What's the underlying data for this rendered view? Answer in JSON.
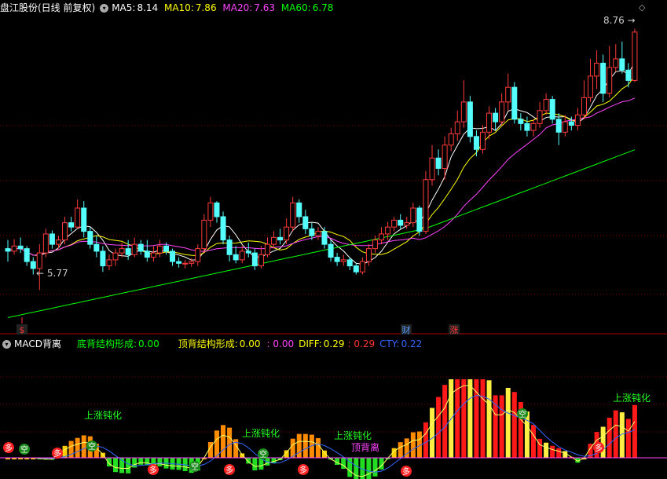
{
  "header": {
    "stock_title": "盘江股份(日线 前复权)",
    "ma5_label": "MA5:",
    "ma5_value": "8.14",
    "ma10_label": "MA10:",
    "ma10_value": "7.86",
    "ma20_label": "MA20:",
    "ma20_value": "7.63",
    "ma60_label": "MA60:",
    "ma60_value": "6.78",
    "colors": {
      "ma5": "#ffffff",
      "ma10": "#ffff00",
      "ma20": "#ff44ff",
      "ma60": "#00ff00"
    }
  },
  "price_chart": {
    "high_label": "8.76",
    "low_label": "5.77",
    "event_markers": [
      "$",
      "财",
      "涨"
    ]
  },
  "indicator_header": {
    "name": "MACD背离",
    "bottom_div_label": "底背结构形成:",
    "bottom_div_value": "0.00",
    "top_div_label": "顶背结构形成:",
    "top_div_value": "0.00",
    "extra_value": ": 0.00",
    "diff_label": "DIFF:",
    "diff_value": "0.29",
    "dea_value": ": 0.29",
    "cty_label": "CTY:",
    "cty_value": "0.22"
  },
  "indicator_annotations": {
    "up_blunt": "上涨钝化",
    "top_divergence": "顶背离",
    "long": "多",
    "short": "空"
  },
  "chart_data": {
    "type": "candlestick",
    "price_range": [
      5.4,
      8.95
    ],
    "ma_series": [
      {
        "name": "MA5",
        "color": "#ffffff"
      },
      {
        "name": "MA10",
        "color": "#ffff00"
      },
      {
        "name": "MA20",
        "color": "#ff44ff"
      },
      {
        "name": "MA60",
        "color": "#00ff00"
      }
    ],
    "candles": [
      [
        6.25,
        6.22,
        6.35,
        6.1
      ],
      [
        6.22,
        6.28,
        6.36,
        6.18
      ],
      [
        6.28,
        6.25,
        6.38,
        6.2
      ],
      [
        6.25,
        6.1,
        6.28,
        6.05
      ],
      [
        6.1,
        6.02,
        6.15,
        5.95
      ],
      [
        6.02,
        6.2,
        6.3,
        5.77
      ],
      [
        6.2,
        6.42,
        6.48,
        6.15
      ],
      [
        6.42,
        6.3,
        6.46,
        6.25
      ],
      [
        6.3,
        6.35,
        6.4,
        6.25
      ],
      [
        6.35,
        6.55,
        6.62,
        6.3
      ],
      [
        6.55,
        6.5,
        6.62,
        6.45
      ],
      [
        6.5,
        6.72,
        6.82,
        6.48
      ],
      [
        6.72,
        6.45,
        6.8,
        6.38
      ],
      [
        6.45,
        6.3,
        6.5,
        6.25
      ],
      [
        6.3,
        6.22,
        6.4,
        6.15
      ],
      [
        6.22,
        6.05,
        6.28,
        5.98
      ],
      [
        6.05,
        6.12,
        6.18,
        6.0
      ],
      [
        6.12,
        6.2,
        6.25,
        6.05
      ],
      [
        6.2,
        6.25,
        6.32,
        6.15
      ],
      [
        6.25,
        6.18,
        6.35,
        6.12
      ],
      [
        6.18,
        6.3,
        6.38,
        6.15
      ],
      [
        6.3,
        6.22,
        6.35,
        6.18
      ],
      [
        6.22,
        6.15,
        6.35,
        6.1
      ],
      [
        6.15,
        6.2,
        6.28,
        6.1
      ],
      [
        6.2,
        6.28,
        6.35,
        6.15
      ],
      [
        6.28,
        6.22,
        6.32,
        6.18
      ],
      [
        6.22,
        6.1,
        6.25,
        6.05
      ],
      [
        6.1,
        6.08,
        6.15,
        6.03
      ],
      [
        6.08,
        6.08,
        6.12,
        6.02
      ],
      [
        6.08,
        6.1,
        6.14,
        6.04
      ],
      [
        6.1,
        6.25,
        6.3,
        6.05
      ],
      [
        6.25,
        6.58,
        6.65,
        6.2
      ],
      [
        6.58,
        6.78,
        6.85,
        6.5
      ],
      [
        6.78,
        6.62,
        6.8,
        6.55
      ],
      [
        6.62,
        6.35,
        6.68,
        6.3
      ],
      [
        6.35,
        6.18,
        6.4,
        6.1
      ],
      [
        6.18,
        6.12,
        6.28,
        6.08
      ],
      [
        6.12,
        6.22,
        6.28,
        6.08
      ],
      [
        6.22,
        6.2,
        6.32,
        6.15
      ],
      [
        6.2,
        6.05,
        6.25,
        6.0
      ],
      [
        6.05,
        6.18,
        6.28,
        6.02
      ],
      [
        6.18,
        6.3,
        6.38,
        6.15
      ],
      [
        6.3,
        6.38,
        6.45,
        6.25
      ],
      [
        6.38,
        6.35,
        6.48,
        6.3
      ],
      [
        6.35,
        6.5,
        6.6,
        6.3
      ],
      [
        6.5,
        6.78,
        6.85,
        6.45
      ],
      [
        6.78,
        6.62,
        6.82,
        6.55
      ],
      [
        6.62,
        6.48,
        6.7,
        6.42
      ],
      [
        6.48,
        6.4,
        6.55,
        6.35
      ],
      [
        6.4,
        6.45,
        6.5,
        6.35
      ],
      [
        6.45,
        6.3,
        6.5,
        6.25
      ],
      [
        6.3,
        6.15,
        6.35,
        6.1
      ],
      [
        6.15,
        6.1,
        6.2,
        6.05
      ],
      [
        6.1,
        6.12,
        6.18,
        6.05
      ],
      [
        6.12,
        6.05,
        6.15,
        6.0
      ],
      [
        6.05,
        5.98,
        6.08,
        5.95
      ],
      [
        5.98,
        6.1,
        6.15,
        5.95
      ],
      [
        6.1,
        6.25,
        6.3,
        6.05
      ],
      [
        6.25,
        6.35,
        6.4,
        6.2
      ],
      [
        6.35,
        6.42,
        6.5,
        6.3
      ],
      [
        6.42,
        6.5,
        6.56,
        6.35
      ],
      [
        6.5,
        6.58,
        6.62,
        6.45
      ],
      [
        6.58,
        6.52,
        6.65,
        6.48
      ],
      [
        6.52,
        6.55,
        6.62,
        6.48
      ],
      [
        6.55,
        6.72,
        6.78,
        6.5
      ],
      [
        6.72,
        6.45,
        6.75,
        6.4
      ],
      [
        6.45,
        7.05,
        7.15,
        6.42
      ],
      [
        7.05,
        7.3,
        7.45,
        6.98
      ],
      [
        7.3,
        7.18,
        7.4,
        7.1
      ],
      [
        7.18,
        7.45,
        7.55,
        7.05
      ],
      [
        7.45,
        7.58,
        7.65,
        7.38
      ],
      [
        7.58,
        7.72,
        7.85,
        7.5
      ],
      [
        7.72,
        7.95,
        8.2,
        7.65
      ],
      [
        7.95,
        7.55,
        8.02,
        7.48
      ],
      [
        7.55,
        7.4,
        7.62,
        7.32
      ],
      [
        7.4,
        7.6,
        7.68,
        7.35
      ],
      [
        7.6,
        7.82,
        7.9,
        7.52
      ],
      [
        7.82,
        7.72,
        7.88,
        7.62
      ],
      [
        7.72,
        7.95,
        8.05,
        7.68
      ],
      [
        7.95,
        8.12,
        8.28,
        7.85
      ],
      [
        8.12,
        7.75,
        8.18,
        7.7
      ],
      [
        7.75,
        7.7,
        7.82,
        7.62
      ],
      [
        7.7,
        7.62,
        7.78,
        7.55
      ],
      [
        7.62,
        7.7,
        7.75,
        7.55
      ],
      [
        7.7,
        7.85,
        7.95,
        7.65
      ],
      [
        7.85,
        7.98,
        8.05,
        7.8
      ],
      [
        7.98,
        7.75,
        8.02,
        7.7
      ],
      [
        7.75,
        7.6,
        7.82,
        7.45
      ],
      [
        7.6,
        7.72,
        7.8,
        7.55
      ],
      [
        7.72,
        7.68,
        7.78,
        7.62
      ],
      [
        7.68,
        7.8,
        7.88,
        7.62
      ],
      [
        7.8,
        8.0,
        8.2,
        7.75
      ],
      [
        8.0,
        8.25,
        8.45,
        7.95
      ],
      [
        8.25,
        8.4,
        8.55,
        8.1
      ],
      [
        8.4,
        8.05,
        8.5,
        7.95
      ],
      [
        8.05,
        8.35,
        8.6,
        8.0
      ],
      [
        8.35,
        8.45,
        8.62,
        8.3
      ],
      [
        8.45,
        8.32,
        8.65,
        8.28
      ],
      [
        8.32,
        8.2,
        8.4,
        8.12
      ],
      [
        8.2,
        8.76,
        8.8,
        8.18
      ]
    ]
  }
}
